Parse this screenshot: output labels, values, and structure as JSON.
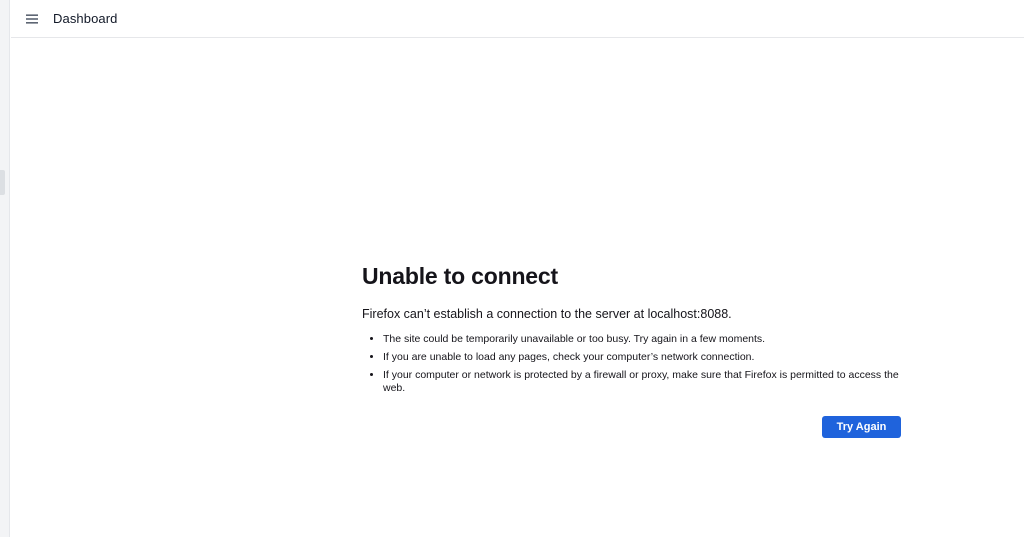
{
  "header": {
    "menu_icon": "hamburger-menu-icon",
    "title": "Dashboard"
  },
  "error": {
    "title": "Unable to connect",
    "description": "Firefox can’t establish a connection to the server at localhost:8088.",
    "items": [
      "The site could be temporarily unavailable or too busy. Try again in a few moments.",
      "If you are unable to load any pages, check your computer’s network connection.",
      "If your computer or network is protected by a firewall or proxy, make sure that Firefox is permitted to access the web."
    ],
    "button_label": "Try Again"
  },
  "colors": {
    "button_bg": "#1f63dc",
    "text": "#15141a",
    "side_rail": "#f3f4f6"
  }
}
